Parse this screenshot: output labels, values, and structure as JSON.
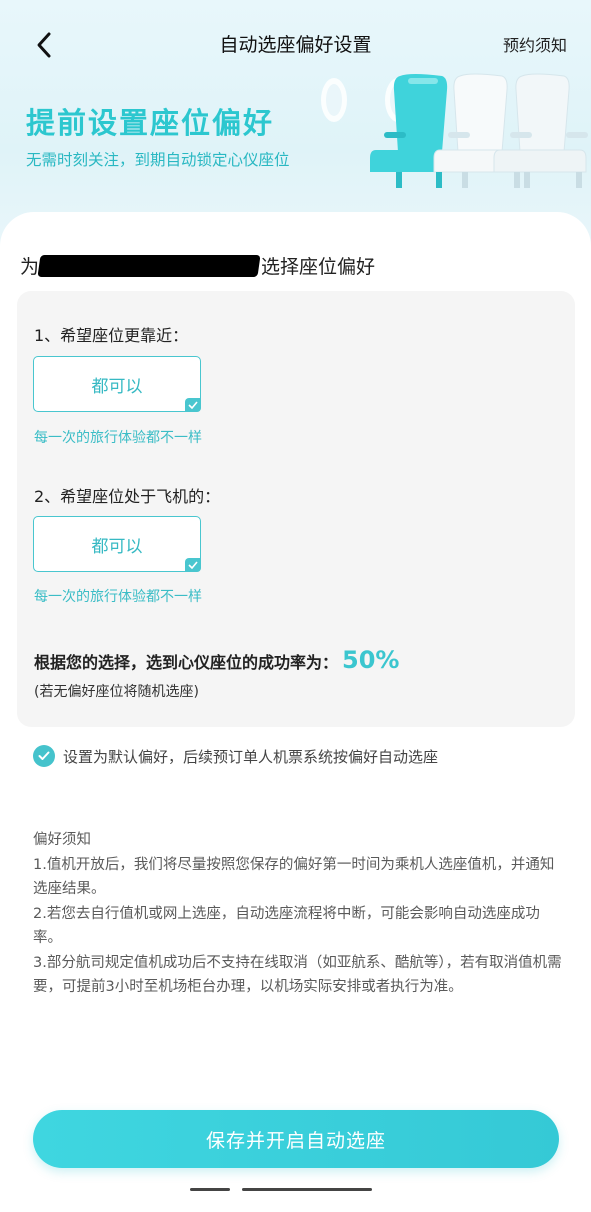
{
  "nav": {
    "title": "自动选座偏好设置",
    "right_link": "预约须知"
  },
  "hero": {
    "title": "提前设置座位偏好",
    "subtitle": "无需时刻关注，到期自动锁定心仪座位"
  },
  "passenger": {
    "prefix": "为",
    "suffix": "选择座位偏好"
  },
  "questions": [
    {
      "title": "1、希望座位更靠近：",
      "option": "都可以",
      "hint": "每一次的旅行体验都不一样"
    },
    {
      "title": "2、希望座位处于飞机的：",
      "option": "都可以",
      "hint": "每一次的旅行体验都不一样"
    }
  ],
  "result": {
    "label": "根据您的选择，选到心仪座位的成功率为：",
    "value": "50%",
    "note": "(若无偏好座位将随机选座)"
  },
  "default_pref": {
    "text": "设置为默认偏好，后续预订单人机票系统按偏好自动选座",
    "checked": true
  },
  "notice": {
    "title": "偏好须知",
    "items": [
      "1.值机开放后，我们将尽量按照您保存的偏好第一时间为乘机人选座值机，并通知选座结果。",
      "2.若您去自行值机或网上选座，自动选座流程将中断，可能会影响自动选座成功率。",
      "3.部分航司规定值机成功后不支持在线取消（如亚航系、酷航等），若有取消值机需要，可提前3小时至机场柜台办理，以机场实际安排或者执行为准。"
    ]
  },
  "save_button": "保存并开启自动选座",
  "colors": {
    "accent": "#3bc6cf",
    "hero_bg": "#e3f5f9",
    "panel_bg": "#f5f5f5"
  }
}
